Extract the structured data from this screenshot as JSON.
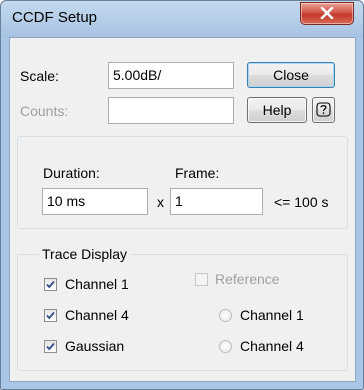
{
  "window": {
    "title": "CCDF Setup"
  },
  "scale": {
    "label": "Scale:",
    "value": "5.00dB/"
  },
  "counts": {
    "label": "Counts:",
    "value": ""
  },
  "buttons": {
    "close": "Close",
    "help": "Help"
  },
  "duration": {
    "label": "Duration:",
    "value": "10 ms"
  },
  "frame": {
    "label": "Frame:",
    "value": "1",
    "multiplier": "x",
    "limit": "<= 100 s"
  },
  "trace_display": {
    "legend": "Trace Display",
    "checkboxes": [
      {
        "label": "Channel 1",
        "checked": true
      },
      {
        "label": "Channel 4",
        "checked": true
      },
      {
        "label": "Gaussian",
        "checked": true
      }
    ],
    "reference": {
      "label": "Reference",
      "checked": false,
      "enabled": false
    },
    "radios": [
      {
        "label": "Channel 1",
        "selected": false,
        "enabled": false
      },
      {
        "label": "Channel 4",
        "selected": false,
        "enabled": false
      }
    ]
  },
  "icons": [
    "close-x-icon",
    "context-help-icon",
    "checkmark-icon"
  ]
}
